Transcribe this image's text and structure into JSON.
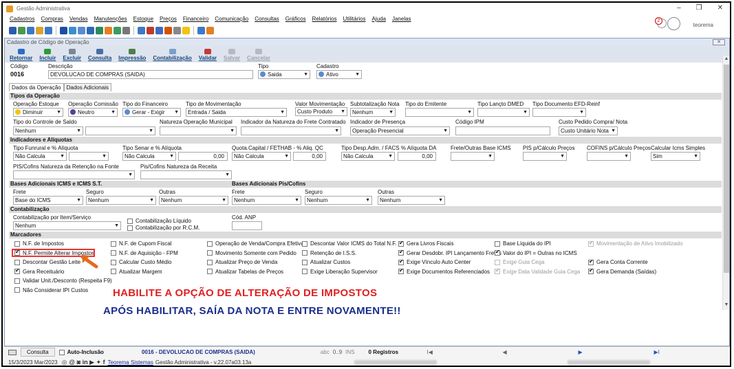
{
  "window": {
    "title": "Gestão Administrativa",
    "min": "–",
    "max": "❐",
    "close": "✕"
  },
  "menu": [
    "Cadastros",
    "Compras",
    "Vendas",
    "Manutenções",
    "Estoque",
    "Preços",
    "Financeiro",
    "Comunicação",
    "Consultas",
    "Gráficos",
    "Relatórios",
    "Utilitários",
    "Ajuda",
    "Janelas"
  ],
  "header": {
    "notification_count": "2",
    "user": "teorema"
  },
  "form": {
    "title": "Cadastro de Código de Operação",
    "close_label": "✕",
    "actions": [
      {
        "label": "Retornar",
        "color": "#2a6cc7",
        "enabled": true
      },
      {
        "label": "Incluir",
        "color": "#2f9a37",
        "enabled": true
      },
      {
        "label": "Excluir",
        "color": "#7b8794",
        "enabled": true
      },
      {
        "label": "Consulta",
        "color": "#4a6fa5",
        "enabled": true
      },
      {
        "label": "Impressão",
        "color": "#4e7f4e",
        "enabled": true
      },
      {
        "label": "Contabilização",
        "color": "#7aa0c8",
        "enabled": true
      },
      {
        "label": "Validar",
        "color": "#c23a3a",
        "enabled": true
      },
      {
        "label": "Salvar",
        "color": "#b4bac2",
        "enabled": false
      },
      {
        "label": "Cancelar",
        "color": "#b4bac2",
        "enabled": false
      }
    ],
    "codigo_label": "Código",
    "codigo": "0016",
    "descricao_label": "Descrição",
    "descricao": "DEVOLUCAO DE COMPRAS (SAIDA)",
    "tipo_label": "Tipo",
    "tipo": "Saida",
    "cadastro_label": "Cadastro",
    "cadastro": "Ativo",
    "tabs": [
      "Dados da Operação",
      "Dados Adicionais"
    ]
  },
  "sections": {
    "tipos": "Tipos da Operação",
    "indicadores": "Indicadores e Alíquotas",
    "bases_icms": "Bases Adicionais ICMS e ICMS S.T.",
    "bases_pis": "Bases Adicionais Pis/Cofins",
    "contabilizacao": "Contabilização",
    "marcadores": "Marcadores"
  },
  "tipos": {
    "op_estoque_label": "Operação Estoque",
    "op_estoque": "Diminuir",
    "op_comissao_label": "Operação Comissão",
    "op_comissao": "Neutro",
    "tipo_fin_label": "Tipo do Financeiro",
    "tipo_fin": "Gerar - Exigir",
    "tipo_mov_label": "Tipo de Movimentação",
    "tipo_mov": "Entrada / Saida",
    "valor_mov_label": "Valor Movimentação",
    "valor_mov": "Custo Produto",
    "subtot_label": "Subtotalização Nota",
    "subtot": "Nenhum",
    "tipo_emit_label": "Tipo do Emitente",
    "tipo_emit": "",
    "tipo_dmed_label": "Tipo Lançto DMED",
    "tipo_dmed": "",
    "tipo_efd_label": "Tipo Documento EFD-Reinf",
    "tipo_efd": "",
    "ctrl_saldo_label": "Tipo do Controle de Saldo",
    "ctrl_saldo": "Nenhum",
    "ctrl_saldo2": "",
    "nat_mun_label": "Natureza Operação Municipal",
    "nat_mun": "",
    "ind_frete_label": "Indicador da Natureza do Frete Contratado",
    "ind_frete": "",
    "ind_pres_label": "Indicador de Presença",
    "ind_pres": "Operação Presencial",
    "ipm_label": "Código IPM",
    "ipm": "",
    "custo_ped_label": "Custo Pedido Compra/ Nota",
    "custo_ped": "Custo Unitário Nota"
  },
  "indicadores": {
    "funrural_label": "Tipo Funrural e % Alíquota",
    "funrural": "Não Calcula",
    "funrural2": "",
    "senar_label": "Tipo Senar e % Alíquota",
    "senar": "Não Calcula",
    "senar_pct": "0,00",
    "quota_label": "Quota.Capital / FETHAB - % Aliq. QC",
    "quota": "Não Calcula",
    "quota_pct": "0,00",
    "desp_label": "Tipo Desp.Adm. / FACS % Alíquota DA",
    "desp": "Não Calcula",
    "desp_pct": "0,00",
    "frete_label": "Frete/Outras Base ICMS",
    "frete": "",
    "pis_calc_label": "PIS p/Cálculo Preços",
    "pis_calc": "",
    "cofins_label": "COFINS p/Cálculo Preços",
    "cofins": "",
    "icms_simples_label": "Calcular Icms Simples",
    "icms_simples": "Sim",
    "nat_ret_label": "PIS/Cofins Natureza da Retenção na Fonte",
    "nat_ret": "",
    "nat_rec_label": "Pis/Cofins Natureza da Receita",
    "nat_rec": ""
  },
  "bases": {
    "frete_label": "Frete",
    "seguro_label": "Seguro",
    "outras_label": "Outras",
    "icms_frete": "Base do ICMS",
    "icms_seguro": "Nenhum",
    "icms_outras": "Nenhum",
    "pis_frete": "Nenhum",
    "pis_seguro": "Nenhum",
    "pis_outras": "Nenhum"
  },
  "contab": {
    "por_item_label": "Contabilização por Item/Serviço",
    "por_item": "Nenhum",
    "liquido": "Contabilização Líquido",
    "rcm": "Contabilização por R.C.M.",
    "anp_label": "Cód. ANP",
    "anp": ""
  },
  "marcadores": [
    {
      "label": "N.F. de Impostos",
      "checked": false,
      "disabled": false
    },
    {
      "label": "N.F. Permite Alterar Impostos",
      "checked": true,
      "disabled": false
    },
    {
      "label": "Descontar Gestão Leite",
      "checked": false,
      "disabled": false
    },
    {
      "label": "Gera Receituário",
      "checked": true,
      "disabled": false
    },
    {
      "label": "Validar Unit./Desconto (Respeita F9)",
      "checked": false,
      "disabled": false
    },
    {
      "label": "Não Considerar IPI Custos",
      "checked": false,
      "disabled": false
    },
    {
      "label": "N.F. de Cupom Fiscal",
      "checked": false,
      "disabled": false
    },
    {
      "label": "N.F. de Aquisição - FPM",
      "checked": false,
      "disabled": false
    },
    {
      "label": "Calcular Custo Médio",
      "checked": false,
      "disabled": false
    },
    {
      "label": "Atualizar Margem",
      "checked": false,
      "disabled": false
    },
    {
      "label": "Operação de Venda/Compra Efetiva",
      "checked": false,
      "disabled": false
    },
    {
      "label": "Movimento Somente com Pedido",
      "checked": false,
      "disabled": false
    },
    {
      "label": "Atualizar Preço de Venda",
      "checked": false,
      "disabled": false
    },
    {
      "label": "Atualizar Tabelas de Preços",
      "checked": false,
      "disabled": false
    },
    {
      "label": "Descontar Valor ICMS do Total N.F.",
      "checked": false,
      "disabled": false
    },
    {
      "label": "Retenção de I.S.S.",
      "checked": false,
      "disabled": false
    },
    {
      "label": "Atualizar Custos",
      "checked": false,
      "disabled": false
    },
    {
      "label": "Exige Liberação Supervisor",
      "checked": false,
      "disabled": false
    },
    {
      "label": "Gera Livros Fiscais",
      "checked": true,
      "disabled": false
    },
    {
      "label": "Gerar Desdobr. IPI Lançamento Fretes",
      "checked": true,
      "disabled": false
    },
    {
      "label": "Exige Vínculo Auto Center",
      "checked": true,
      "disabled": false
    },
    {
      "label": "Exige Documentos Referenciados",
      "checked": true,
      "disabled": false
    },
    {
      "label": "Base Líquida do IPI",
      "checked": false,
      "disabled": false
    },
    {
      "label": "Valor do IPI = Outras no ICMS",
      "checked": true,
      "disabled": false
    },
    {
      "label": "Exige Guia Cega",
      "checked": false,
      "disabled": true
    },
    {
      "label": "Exige Data Validade Guia Cega",
      "checked": true,
      "disabled": true
    },
    {
      "label": "Movimentação de Ativo Imobilizado",
      "checked": true,
      "disabled": true
    },
    {
      "label": "Gera Conta Corrente",
      "checked": true,
      "disabled": false
    },
    {
      "label": "Gera Demanda (Saídas)",
      "checked": true,
      "disabled": false
    }
  ],
  "annotation": {
    "line1": "HABILITE A OPÇÃO DE ALTERAÇÃO DE IMPOSTOS",
    "line2": "APÓS HABILITAR, SAÍA DA NOTA E ENTRE NOVAMENTE!!"
  },
  "statusbar": {
    "consulta": "Consulta",
    "auto_inclusao": "Auto-Inclusão",
    "record": "0016 - DEVOLUCAO DE COMPRAS (SAIDA)",
    "abc": "abc",
    "range": "0..9",
    "ins": "INS",
    "registros": "0 Registros",
    "first": "I◀",
    "prev": "◀",
    "next": "▶",
    "last": "▶I"
  },
  "bottom": {
    "date": "15/3/2023 Mar/2023",
    "company": "Teorema Sistemas",
    "app": "Gestão Administrativa - v.22.07a03.13a"
  }
}
